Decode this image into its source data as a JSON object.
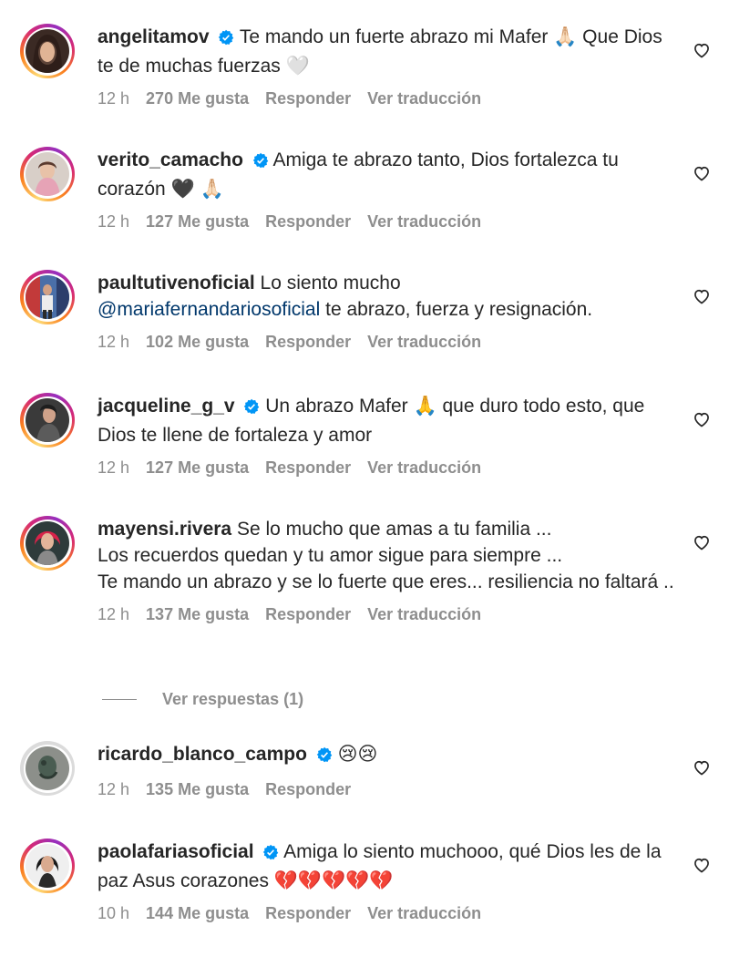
{
  "comments": [
    {
      "username": "angelitamov",
      "verified": true,
      "text": "Te mando un fuerte abrazo mi Mafer 🙏🏻 Que Dios te de muchas fuerzas 🤍",
      "time": "12 h",
      "likes": "270 Me gusta",
      "reply": "Responder",
      "translate": "Ver traducción"
    },
    {
      "username": "verito_camacho",
      "verified": true,
      "text": "Amiga te abrazo tanto, Dios fortalezca tu corazón 🖤 🙏🏻",
      "time": "12 h",
      "likes": "127 Me gusta",
      "reply": "Responder",
      "translate": "Ver traducción"
    },
    {
      "username": "paultutivenoficial",
      "verified": false,
      "text_before": "Lo siento mucho",
      "mention": "@mariafernandariosoficial",
      "text_after": "te abrazo, fuerza y resignación.",
      "time": "12 h",
      "likes": "102 Me gusta",
      "reply": "Responder",
      "translate": "Ver traducción"
    },
    {
      "username": "jacqueline_g_v",
      "verified": true,
      "text": "Un abrazo Mafer 🙏 que duro todo esto, que Dios te llene de fortaleza y amor",
      "time": "12 h",
      "likes": "127 Me gusta",
      "reply": "Responder",
      "translate": "Ver traducción"
    },
    {
      "username": "mayensi.rivera",
      "verified": false,
      "line1": "Se lo mucho que amas a tu familia ...",
      "line2": "Los recuerdos quedan y tu amor sigue para siempre ...",
      "line3": "Te mando un abrazo y se lo fuerte que eres... resiliencia no faltará ..",
      "time": "12 h",
      "likes": "137 Me gusta",
      "reply": "Responder",
      "translate": "Ver traducción"
    },
    {
      "username": "ricardo_blanco_campo",
      "verified": true,
      "text": "😢😢",
      "time": "12 h",
      "likes": "135 Me gusta",
      "reply": "Responder"
    },
    {
      "username": "paolafariasoficial",
      "verified": true,
      "text": "Amiga lo siento muchooo, qué Dios les de la paz Asus corazones 💔💔💔💔💔",
      "time": "10 h",
      "likes": "144 Me gusta",
      "reply": "Responder",
      "translate": "Ver traducción"
    }
  ],
  "view_replies": "Ver respuestas (1)",
  "icons": {
    "verified": "verified-badge-icon",
    "like": "heart-outline-icon"
  },
  "colors": {
    "verified_blue": "#0095f6",
    "muted_text": "#8e8e8e",
    "mention": "#00376b"
  }
}
